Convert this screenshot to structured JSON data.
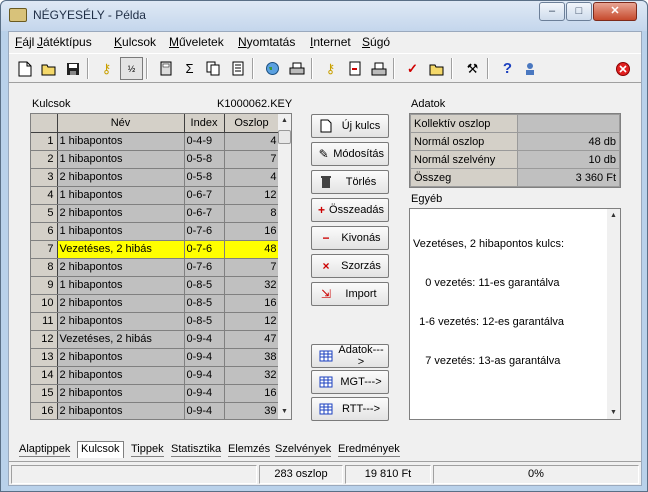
{
  "title": "NÉGYESÉLY - Példa",
  "window_buttons": {
    "minimize": "–",
    "maximize": "□",
    "close": "✕"
  },
  "menu": [
    {
      "pre": "F",
      "post": "ájl"
    },
    {
      "pre": "J",
      "post": "átéktípus"
    },
    {
      "pre": "K",
      "post": "ulcsok"
    },
    {
      "pre": "M",
      "post": "űveletek"
    },
    {
      "pre": "N",
      "post": "yomtatás"
    },
    {
      "pre": "I",
      "post": "nternet"
    },
    {
      "pre": "S",
      "post": "úgó"
    }
  ],
  "toolbar_icons": [
    "new-file-icon",
    "open-folder-icon",
    "save-disk-icon",
    "key-icon",
    "fraction-icon",
    "calculator-icon",
    "sigma-icon",
    "copy-pages-icon",
    "document-icon",
    "globe-icon",
    "printer-icon",
    "key-document-icon",
    "document-export-icon",
    "print-preview-icon",
    "checkmark-icon",
    "folder-pen-icon",
    "tools-icon",
    "help-question-icon",
    "user-key-icon",
    "exit-icon"
  ],
  "kulcsok": {
    "label": "Kulcsok",
    "filename": "K1000062.KEY",
    "headers": {
      "nev": "Név",
      "index": "Index",
      "oszlop": "Oszlop"
    },
    "rows": [
      {
        "n": "1",
        "nev": "1 hibapontos",
        "index": "0-4-9",
        "oszlop": "4"
      },
      {
        "n": "2",
        "nev": "1 hibapontos",
        "index": "0-5-8",
        "oszlop": "7"
      },
      {
        "n": "3",
        "nev": "2 hibapontos",
        "index": "0-5-8",
        "oszlop": "4"
      },
      {
        "n": "4",
        "nev": "1 hibapontos",
        "index": "0-6-7",
        "oszlop": "12"
      },
      {
        "n": "5",
        "nev": "2 hibapontos",
        "index": "0-6-7",
        "oszlop": "8"
      },
      {
        "n": "6",
        "nev": "1 hibapontos",
        "index": "0-7-6",
        "oszlop": "16"
      },
      {
        "n": "7",
        "nev": "Vezetéses, 2 hibás",
        "index": "0-7-6",
        "oszlop": "48"
      },
      {
        "n": "8",
        "nev": "2 hibapontos",
        "index": "0-7-6",
        "oszlop": "7"
      },
      {
        "n": "9",
        "nev": "1 hibapontos",
        "index": "0-8-5",
        "oszlop": "32"
      },
      {
        "n": "10",
        "nev": "2 hibapontos",
        "index": "0-8-5",
        "oszlop": "16"
      },
      {
        "n": "11",
        "nev": "2 hibapontos",
        "index": "0-8-5",
        "oszlop": "12"
      },
      {
        "n": "12",
        "nev": "Vezetéses, 2 hibás",
        "index": "0-9-4",
        "oszlop": "47"
      },
      {
        "n": "13",
        "nev": "2 hibapontos",
        "index": "0-9-4",
        "oszlop": "38"
      },
      {
        "n": "14",
        "nev": "2 hibapontos",
        "index": "0-9-4",
        "oszlop": "32"
      },
      {
        "n": "15",
        "nev": "2 hibapontos",
        "index": "0-9-4",
        "oszlop": "16"
      },
      {
        "n": "16",
        "nev": "2 hibapontos",
        "index": "0-9-4",
        "oszlop": "39"
      }
    ],
    "selected_row": 7
  },
  "action_buttons": [
    {
      "label": "Új kulcs",
      "icon": "new-key-icon"
    },
    {
      "label": "Módosítás",
      "icon": "edit-icon"
    },
    {
      "label": "Törlés",
      "icon": "trash-icon"
    },
    {
      "label": "Összeadás",
      "icon": "add-icon"
    },
    {
      "label": "Kivonás",
      "icon": "subtract-icon"
    },
    {
      "label": "Szorzás",
      "icon": "multiply-icon"
    },
    {
      "label": "Import",
      "icon": "import-icon"
    }
  ],
  "export_buttons": [
    {
      "label": "Adatok--->",
      "icon": "table-icon"
    },
    {
      "label": "MGT--->",
      "icon": "table-icon"
    },
    {
      "label": "RTT--->",
      "icon": "table-icon"
    }
  ],
  "adatok": {
    "label": "Adatok",
    "rows": [
      {
        "k": "Kollektív oszlop",
        "v": ""
      },
      {
        "k": "Normál oszlop",
        "v": "48 db"
      },
      {
        "k": "Normál szelvény",
        "v": "10 db"
      },
      {
        "k": "Összeg",
        "v": "3 360  Ft"
      }
    ]
  },
  "egyeb": {
    "label": "Egyéb",
    "lines": [
      "Vezetéses, 2 hibapontos kulcs:",
      "    0 vezetés: 11-es garantálva",
      "  1-6 vezetés: 12-es garantálva",
      "    7 vezetés: 13-as garantálva"
    ]
  },
  "tabs": [
    "Alaptippek",
    "Kulcsok",
    "Tippek",
    "Statisztika",
    "Elemzés",
    "Szelvények",
    "Eredmények"
  ],
  "active_tab": "Kulcsok",
  "status": {
    "oszlop": "283 oszlop",
    "osszeg": "19 810 Ft",
    "percent": "0%"
  },
  "colors": {
    "selected_row": "#ffff00",
    "cell_bg": "#c0c0c0",
    "header_bg": "#d4d0c8"
  }
}
